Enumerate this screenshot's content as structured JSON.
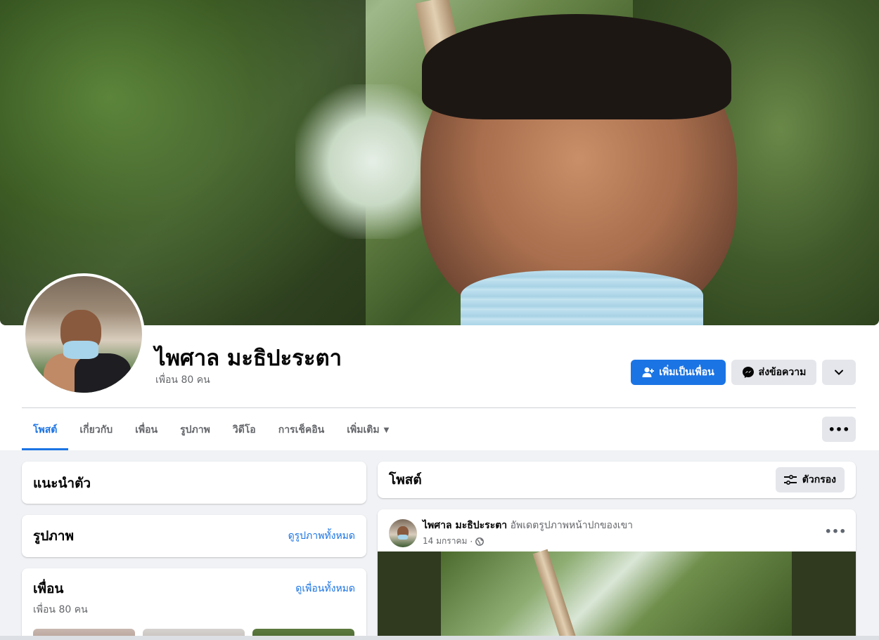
{
  "profile": {
    "name": "ไพศาล มะธิปะระตา",
    "friends_count": "เพื่อน 80 คน"
  },
  "actions": {
    "add_friend": "เพิ่มเป็นเพื่อน",
    "message": "ส่งข้อความ"
  },
  "tabs": [
    {
      "label": "โพสต์",
      "active": true
    },
    {
      "label": "เกี่ยวกับ"
    },
    {
      "label": "เพื่อน"
    },
    {
      "label": "รูปภาพ"
    },
    {
      "label": "วิดีโอ"
    },
    {
      "label": "การเช็คอิน"
    },
    {
      "label": "เพิ่มเติม"
    }
  ],
  "intro": {
    "title": "แนะนำตัว"
  },
  "photos": {
    "title": "รูปภาพ",
    "see_all": "ดูรูปภาพทั้งหมด"
  },
  "friends": {
    "title": "เพื่อน",
    "see_all": "ดูเพื่อนทั้งหมด",
    "count": "เพื่อน 80 คน"
  },
  "posts": {
    "title": "โพสต์",
    "filter": "ตัวกรอง"
  },
  "post": {
    "author": "ไพศาล มะธิปะระตา",
    "action": "อัพเดตรูปภาพหน้าปกของเขา",
    "date": "14 มกราคม",
    "separator": "·"
  },
  "colors": {
    "accent": "#1b74e4",
    "background": "#f0f2f5",
    "button_gray": "#e4e6eb"
  }
}
